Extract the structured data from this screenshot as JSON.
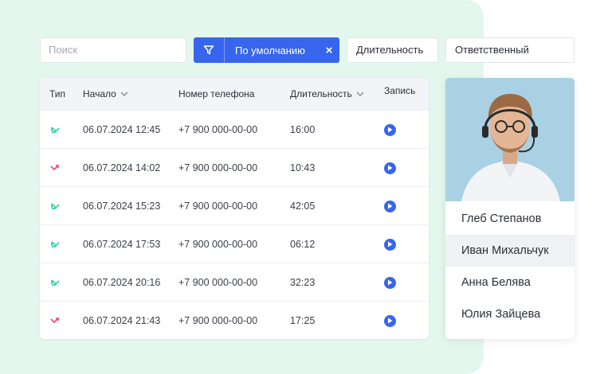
{
  "search": {
    "placeholder": "Поиск"
  },
  "filter": {
    "label": "По умолчанию",
    "close": "×"
  },
  "chips": {
    "duration": "Длительность",
    "responsible": "Ответственный"
  },
  "table": {
    "headers": {
      "type": "Тип",
      "start": "Начало",
      "phone": "Номер телефона",
      "duration": "Длительность",
      "record": "Запись"
    },
    "rows": [
      {
        "direction": "incoming",
        "start": "06.07.2024 12:45",
        "phone": "+7 900 000-00-00",
        "duration": "16:00"
      },
      {
        "direction": "missed",
        "start": "06.07.2024 14:02",
        "phone": "+7 900 000-00-00",
        "duration": "10:43"
      },
      {
        "direction": "incoming",
        "start": "06.07.2024 15:23",
        "phone": "+7 900 000-00-00",
        "duration": "42:05"
      },
      {
        "direction": "incoming",
        "start": "06.07.2024 17:53",
        "phone": "+7 900 000-00-00",
        "duration": "06:12"
      },
      {
        "direction": "incoming",
        "start": "06.07.2024 20:16",
        "phone": "+7 900 000-00-00",
        "duration": "32:23"
      },
      {
        "direction": "missed",
        "start": "06.07.2024 21:43",
        "phone": "+7 900 000-00-00",
        "duration": "17:25"
      }
    ]
  },
  "people": [
    "Глеб Степанов",
    "Иван Михальчук",
    "Анна Белява",
    "Юлия Зайцева"
  ],
  "selected_person_index": 1,
  "colors": {
    "accent": "#3766ec",
    "incoming": "#2fd6a6",
    "missed": "#f0507a",
    "panel_bg": "#e3f7ec"
  }
}
